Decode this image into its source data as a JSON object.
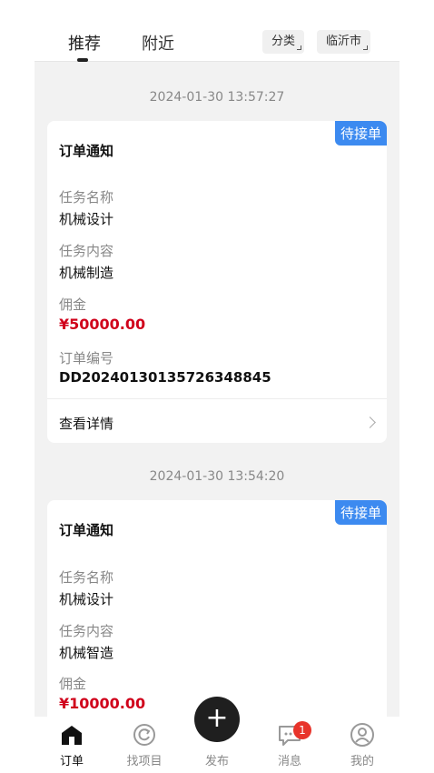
{
  "tabs": {
    "recommend": "推荐",
    "nearby": "附近"
  },
  "filters": {
    "category": "分类",
    "city": "临沂市"
  },
  "orders": [
    {
      "timestamp": "2024-01-30 13:57:27",
      "badge": "待接单",
      "title": "订单通知",
      "task_name_label": "任务名称",
      "task_name": "机械设计",
      "task_content_label": "任务内容",
      "task_content": "机械制造",
      "commission_label": "佣金",
      "commission": "¥50000.00",
      "order_no_label": "订单编号",
      "order_no": "DD20240130135726348845",
      "detail_label": "查看详情"
    },
    {
      "timestamp": "2024-01-30 13:54:20",
      "badge": "待接单",
      "title": "订单通知",
      "task_name_label": "任务名称",
      "task_name": "机械设计",
      "task_content_label": "任务内容",
      "task_content": "机械智造",
      "commission_label": "佣金",
      "commission": "¥10000.00"
    }
  ],
  "nav": {
    "orders": "订单",
    "find_projects": "找项目",
    "publish": "发布",
    "messages": "消息",
    "mine": "我的",
    "message_badge": "1"
  },
  "colors": {
    "accent": "#3c8af0",
    "price": "#d0021b",
    "badge_red": "#e8342b"
  }
}
